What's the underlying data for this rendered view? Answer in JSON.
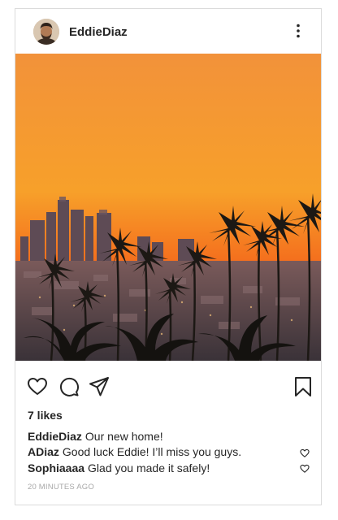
{
  "post": {
    "username": "EddieDiaz",
    "likes": "7 likes",
    "caption": {
      "author": "EddieDiaz",
      "text": "Our new home!"
    },
    "comments": [
      {
        "author": "ADiaz",
        "text": "Good luck Eddie! I’ll miss you guys."
      },
      {
        "author": "Sophiaaaa",
        "text": "Glad you made it safely!"
      }
    ],
    "timestamp": "20 MINUTES AGO"
  },
  "icons": {
    "header": [
      "avatar",
      "more-options-icon"
    ],
    "actions": [
      "heart-icon",
      "comment-icon",
      "share-icon",
      "bookmark-icon"
    ],
    "comment_like": "heart-icon"
  },
  "photo": {
    "subject": "city skyline at sunset with palm trees",
    "colors": {
      "sky_top": "#f28a2a",
      "sky_bottom": "#f4531a",
      "city": "#5a4a52",
      "palms": "#1a1714"
    }
  }
}
